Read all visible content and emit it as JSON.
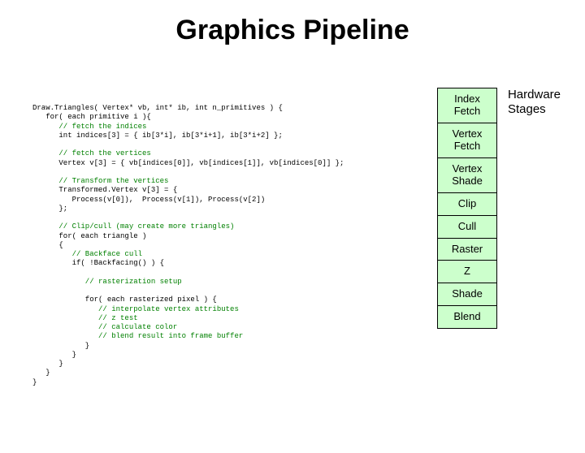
{
  "title": "Graphics Pipeline",
  "hardware_label_l1": "Hardware",
  "hardware_label_l2": "Stages",
  "code": {
    "l01": "Draw.Triangles( Vertex* vb, int* ib, int n_primitives ) {",
    "l02": "   for( each primitive i ){",
    "l03": "      // fetch the indices",
    "l04": "      int indices[3] = { ib[3*i], ib[3*i+1], ib[3*i+2] };",
    "l05": "",
    "l06": "      // fetch the vertices",
    "l07": "      Vertex v[3] = { vb[indices[0]], vb[indices[1]], vb[indices[0]] };",
    "l08": "",
    "l09": "      // Transform the vertices",
    "l10": "      Transformed.Vertex v[3] = {",
    "l11": "         Process(v[0]),  Process(v[1]), Process(v[2])",
    "l12": "      };",
    "l13": "",
    "l14": "      // Clip/cull (may create more triangles)",
    "l15": "      for( each triangle )",
    "l16": "      {",
    "l17": "         // Backface cull",
    "l18": "         if( !Backfacing() ) {",
    "l19": "",
    "l20": "            // rasterization setup",
    "l21": "",
    "l22": "            for( each rasterized pixel ) {",
    "l23": "               // interpolate vertex attributes",
    "l24": "               // z test",
    "l25": "               // calculate color",
    "l26": "               // blend result into frame buffer",
    "l27": "            }",
    "l28": "         }",
    "l29": "      }",
    "l30": "   }",
    "l31": "}"
  },
  "stages": {
    "s0a": "Index",
    "s0b": "Fetch",
    "s1a": "Vertex",
    "s1b": "Fetch",
    "s2a": "Vertex",
    "s2b": "Shade",
    "s3": "Clip",
    "s4": "Cull",
    "s5": "Raster",
    "s6": "Z",
    "s7": "Shade",
    "s8": "Blend"
  }
}
